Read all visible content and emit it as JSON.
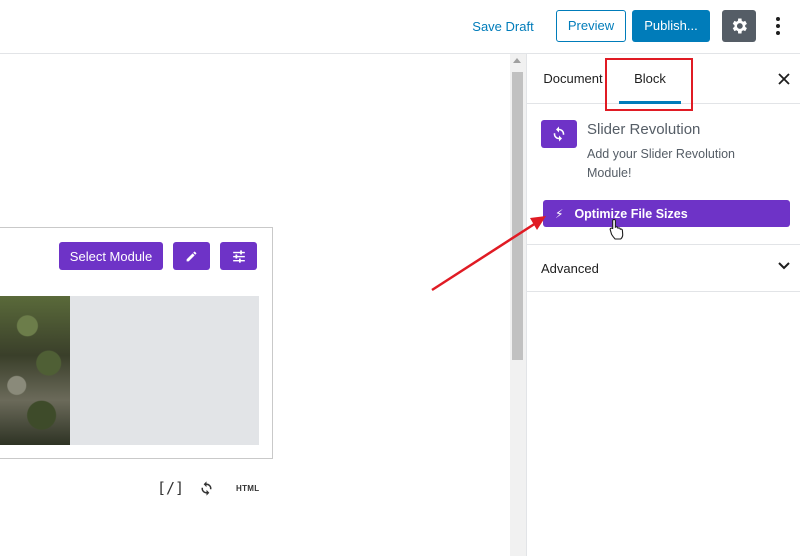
{
  "topbar": {
    "save_draft": "Save Draft",
    "preview": "Preview",
    "publish": "Publish...",
    "settings_icon": "gear-icon",
    "more_icon": "vertical-ellipsis-icon"
  },
  "canvas": {
    "select_module": "Select Module",
    "edit_icon": "pencil-icon",
    "options_icon": "sliders-icon",
    "shortcode": "[/]",
    "refresh_icon": "refresh-icon",
    "html_label": "HTML"
  },
  "sidebar": {
    "tabs": [
      {
        "label": "Document",
        "active": false
      },
      {
        "label": "Block",
        "active": true
      }
    ],
    "close_icon": "close-icon",
    "block": {
      "title": "Slider Revolution",
      "description": "Add your Slider Revolution Module!",
      "icon": "refresh-icon"
    },
    "optimize_button": "Optimize File Sizes",
    "advanced": "Advanced"
  },
  "colors": {
    "accent_blue": "#007cba",
    "purple": "#6e33c7",
    "annotation_red": "#e01b24",
    "settings_gray": "#555d66"
  }
}
